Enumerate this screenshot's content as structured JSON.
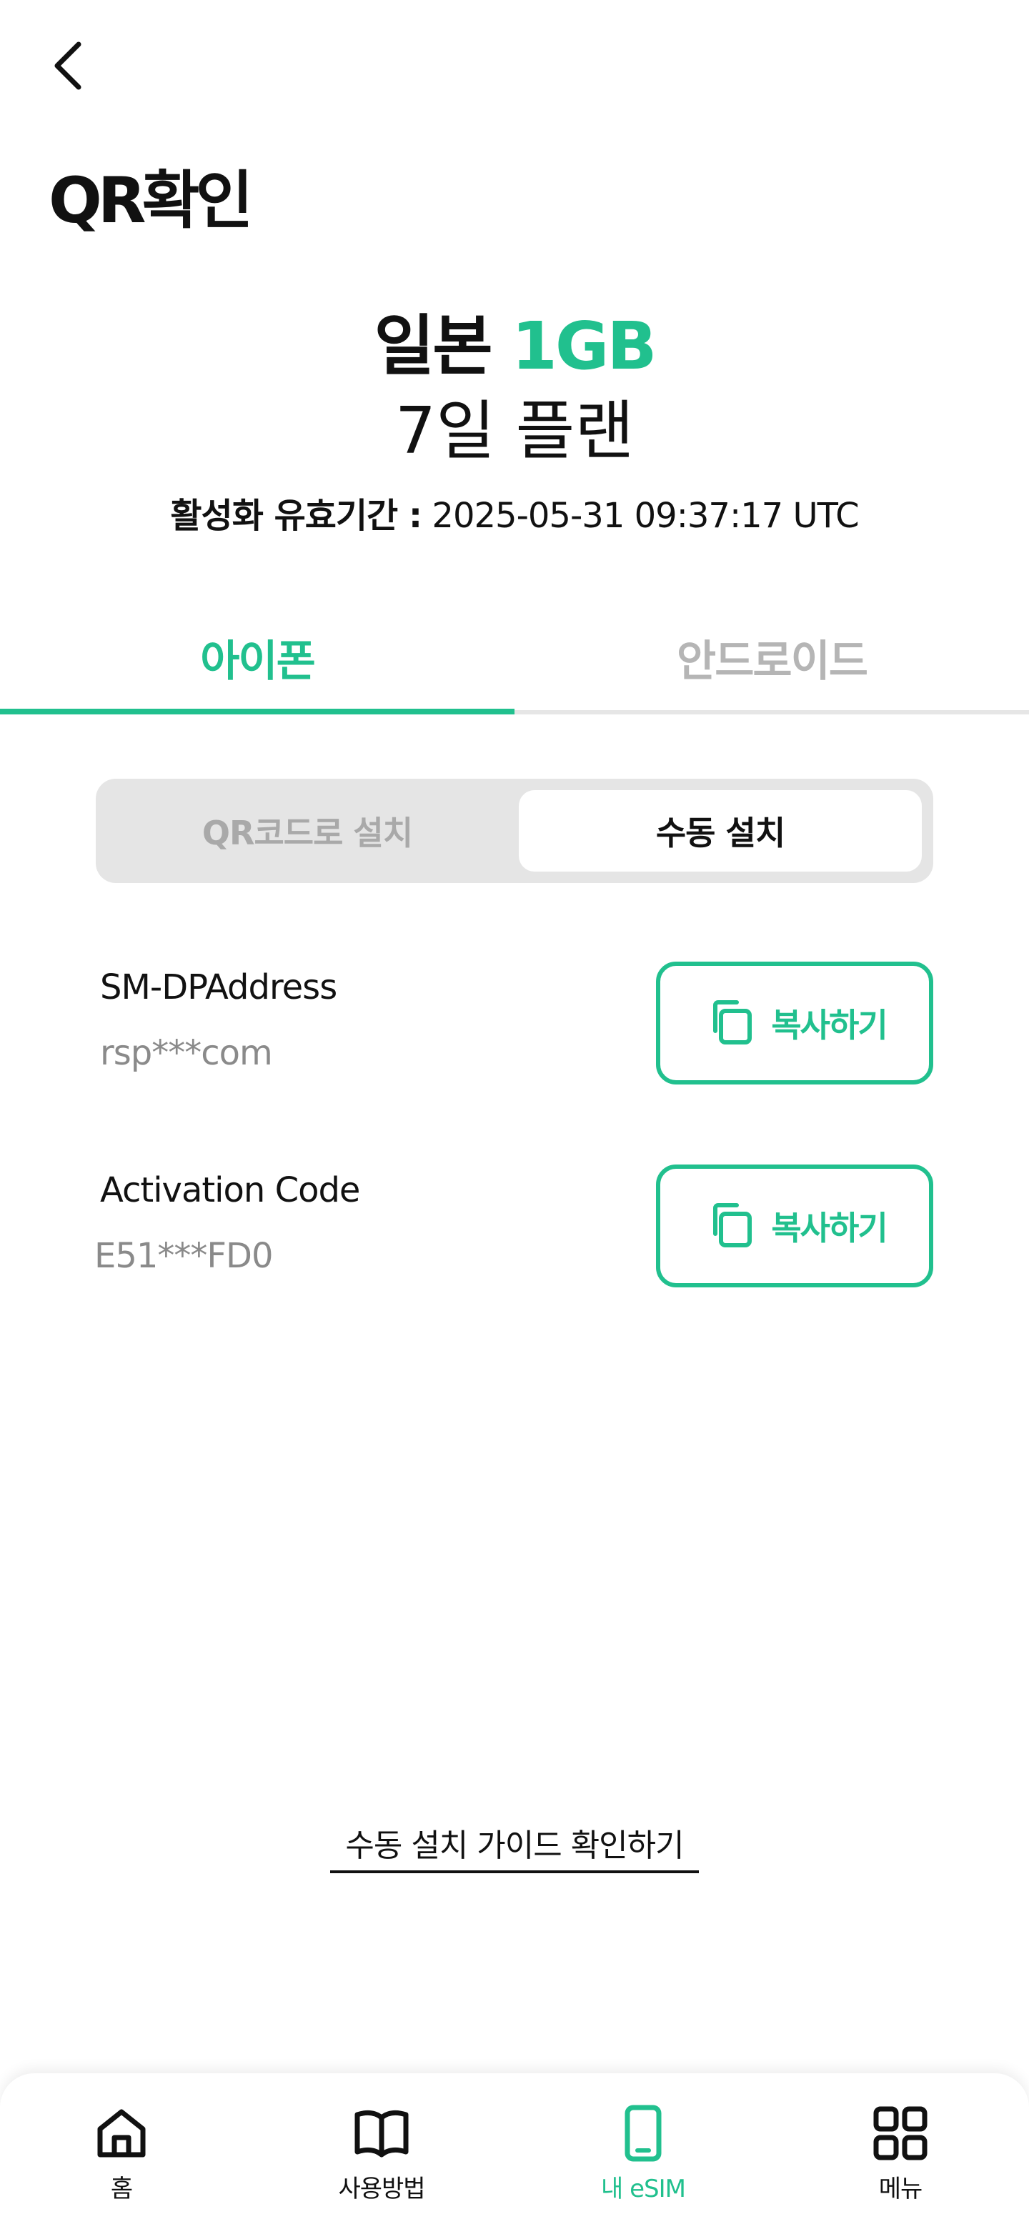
{
  "header": {
    "title": "QR확인",
    "back_icon": "chevron-left-icon"
  },
  "plan": {
    "country": "일본",
    "data_amount": "1GB",
    "duration": "7일 플랜",
    "validity_label": "활성화 유효기간 :",
    "validity_value": "2025-05-31 09:37:17 UTC"
  },
  "os_tabs": [
    {
      "label": "아이폰",
      "active": true
    },
    {
      "label": "안드로이드",
      "active": false
    }
  ],
  "install_mode": [
    {
      "label": "QR코드로 설치",
      "active": false
    },
    {
      "label": "수동 설치",
      "active": true
    }
  ],
  "fields": [
    {
      "label": "SM-DPAddress",
      "value": "rsp***com",
      "copy_label": "복사하기"
    },
    {
      "label": "Activation Code",
      "value": "E51***FD0",
      "copy_label": "복사하기"
    }
  ],
  "guide_link": "수동 설치 가이드 확인하기",
  "bottom_nav": [
    {
      "label": "홈",
      "icon": "home-icon",
      "active": false
    },
    {
      "label": "사용방법",
      "icon": "book-icon",
      "active": false
    },
    {
      "label": "내 eSIM",
      "icon": "phone-icon",
      "active": true
    },
    {
      "label": "메뉴",
      "icon": "grid-icon",
      "active": false
    }
  ],
  "colors": {
    "accent": "#21c08e",
    "inactive_text": "#b5b5b5",
    "segment_bg": "#e5e5e5"
  }
}
